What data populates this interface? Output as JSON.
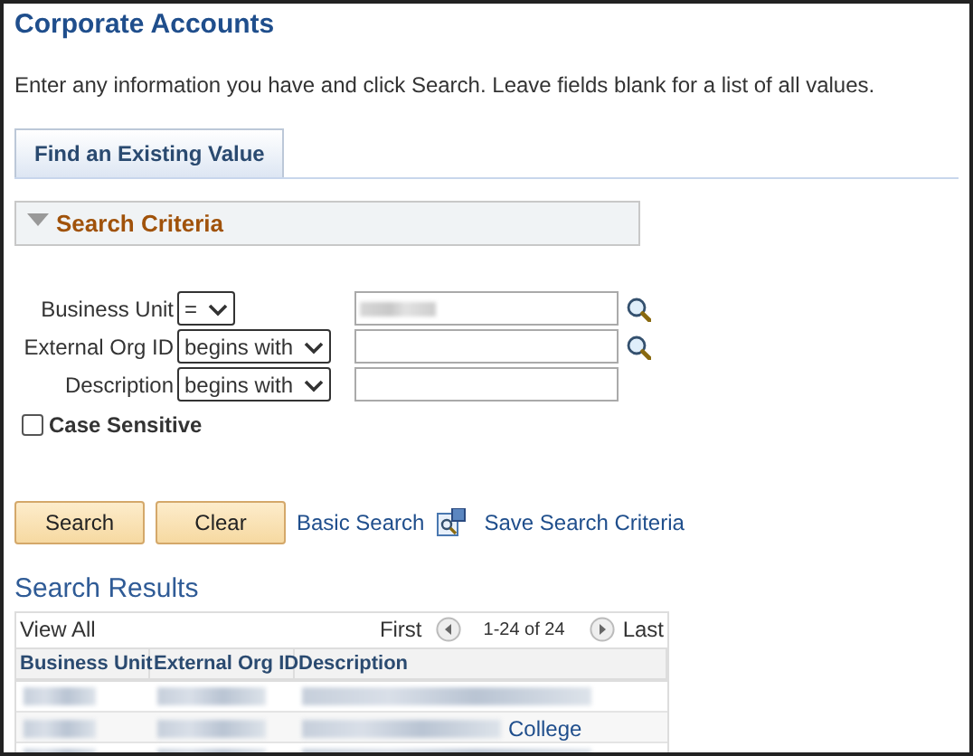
{
  "page": {
    "title": "Corporate Accounts",
    "instructions": "Enter any information you have and click Search. Leave fields blank for a list of all values."
  },
  "tabs": [
    {
      "label": "Find an Existing Value",
      "selected": true
    }
  ],
  "search_criteria": {
    "title": "Search Criteria",
    "expanded": true,
    "fields": [
      {
        "label": "Business Unit",
        "operator": "=",
        "value_blurred": true,
        "lookup": true
      },
      {
        "label": "External Org ID",
        "operator": "begins with",
        "value_blurred": false,
        "lookup": true
      },
      {
        "label": "Description",
        "operator": "begins with",
        "value_blurred": false,
        "lookup": false
      }
    ],
    "case_sensitive": {
      "label": "Case Sensitive",
      "checked": false
    }
  },
  "actions": {
    "buttons": [
      "Search",
      "Clear"
    ],
    "basic_search": "Basic Search",
    "save_criteria": "Save Search Criteria"
  },
  "results": {
    "title": "Search Results",
    "view_all": "View All",
    "first": "First",
    "range": "1-24 of 24",
    "last": "Last",
    "columns": [
      "Business Unit",
      "External Org ID",
      "Description"
    ],
    "rows": [
      {
        "blurred": true
      },
      {
        "blurred": true,
        "description_tail": "College"
      },
      {
        "blurred": true
      }
    ]
  }
}
